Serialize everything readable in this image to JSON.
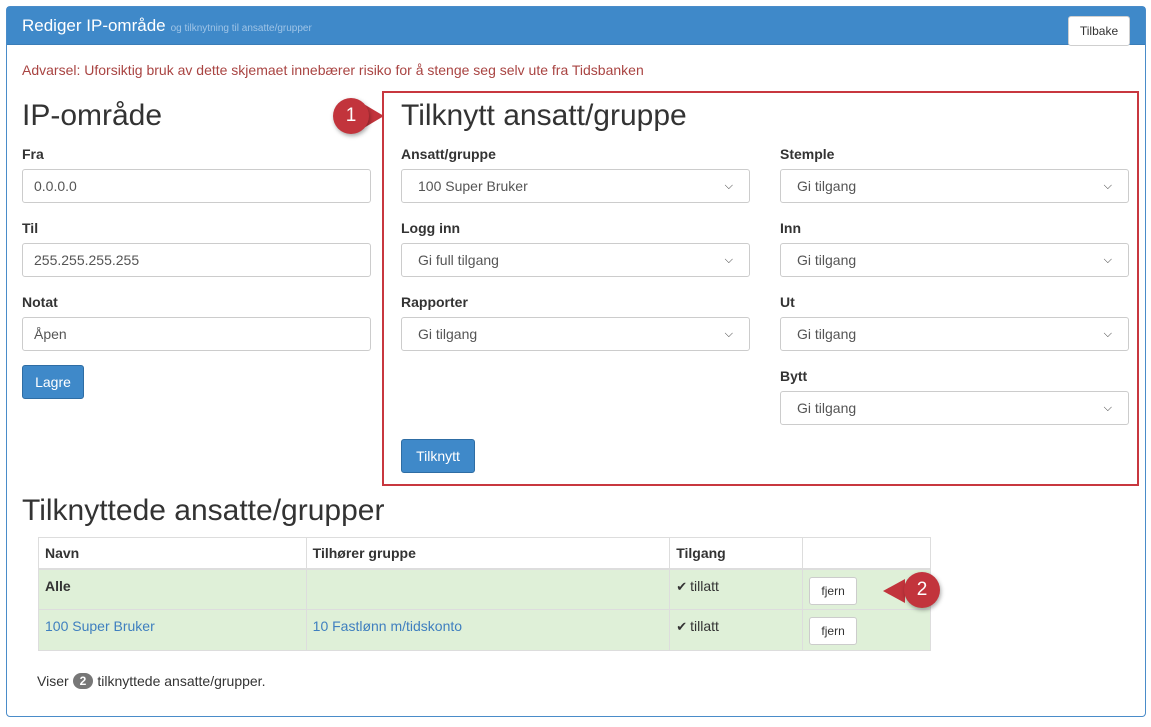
{
  "header": {
    "title": "Rediger IP-område",
    "subtitle": "og tilknytning til ansatte/grupper",
    "back_label": "Tilbake"
  },
  "warning": "Advarsel: Uforsiktig bruk av dette skjemaet innebærer risiko for å stenge seg selv ute fra Tidsbanken",
  "ip_section": {
    "title": "IP-område",
    "from_label": "Fra",
    "from_value": "0.0.0.0",
    "to_label": "Til",
    "to_value": "255.255.255.255",
    "note_label": "Notat",
    "note_value": "Åpen",
    "save_label": "Lagre"
  },
  "assign_section": {
    "title": "Tilknytt ansatt/gruppe",
    "employee_label": "Ansatt/gruppe",
    "employee_value": "100 Super Bruker",
    "login_label": "Logg inn",
    "login_value": "Gi full tilgang",
    "reports_label": "Rapporter",
    "reports_value": "Gi tilgang",
    "stamp_label": "Stemple",
    "stamp_value": "Gi tilgang",
    "in_label": "Inn",
    "in_value": "Gi tilgang",
    "out_label": "Ut",
    "out_value": "Gi tilgang",
    "swap_label": "Bytt",
    "swap_value": "Gi tilgang",
    "assign_button": "Tilknytt"
  },
  "callouts": {
    "one": "1",
    "two": "2"
  },
  "assigned": {
    "title": "Tilknyttede ansatte/grupper",
    "columns": [
      "Navn",
      "Tilhører gruppe",
      "Tilgang",
      ""
    ],
    "rows": [
      {
        "name": "Alle",
        "group": "",
        "access": "tillatt",
        "action": "fjern"
      },
      {
        "name": "100 Super Bruker",
        "group": "10 Fastlønn m/tidskonto",
        "access": "tillatt",
        "action": "fjern"
      }
    ],
    "footer_prefix": "Viser",
    "footer_count": "2",
    "footer_suffix": "tilknyttede ansatte/grupper."
  },
  "icons": {
    "check": "check-icon",
    "chevron": "chevron-down-icon"
  },
  "colors": {
    "header_bg": "#3f89c9",
    "warning": "#a94442",
    "highlight_box": "#c8373f",
    "row_success": "#dff0d8"
  }
}
